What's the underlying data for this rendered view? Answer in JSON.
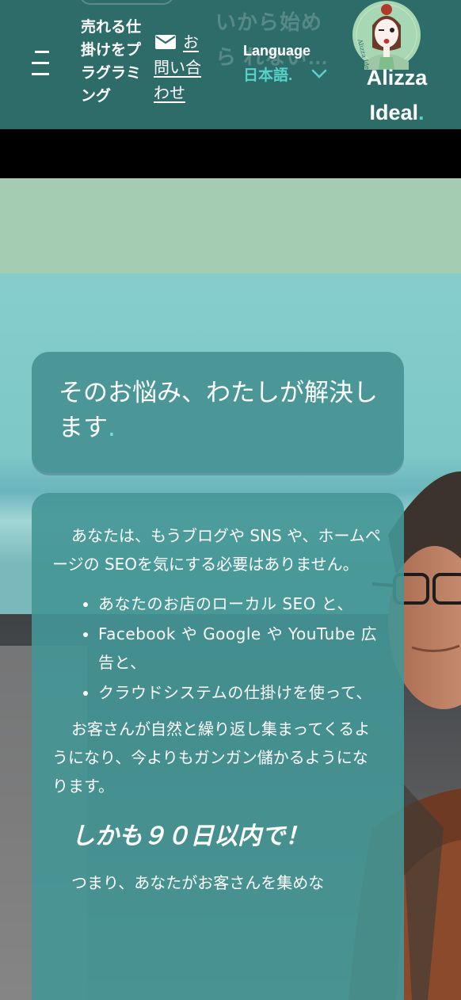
{
  "header": {
    "ghost_text": "いから始めら れない…",
    "tagline": "売れる仕掛けをプラグラミング",
    "contact_label": "お問い合わせ",
    "language_label": "Language",
    "language_value": "日本語",
    "language_dot": ".",
    "brand_name": "Alizza Ideal",
    "brand_dot": ".",
    "logo_text": "Alizza Ideal",
    "accent_color": "#58d1c9",
    "header_color": "#2e6c6a",
    "icons": [
      "menu-icon",
      "mail-icon",
      "chevron-down-icon",
      "logo-avatar"
    ]
  },
  "hero": {
    "title": "そのお悩み、わたしが解決します",
    "title_dot": ".",
    "intro": "あなたは、もうブログや SNS や、ホームページの SEOを気にする必要はありません。",
    "bullets": [
      "あなたのお店のローカル SEO と、",
      "Facebook や Google や YouTube 広告と、",
      "クラウドシステムの仕掛けを使って、"
    ],
    "result": "お客さんが自然と繰り返し集まってくるようになり、今よりもガンガン儲かるようになります。",
    "emphasis": "しかも９０日以内で！",
    "continuation": "つまり、あなたがお客さんを集めな"
  }
}
